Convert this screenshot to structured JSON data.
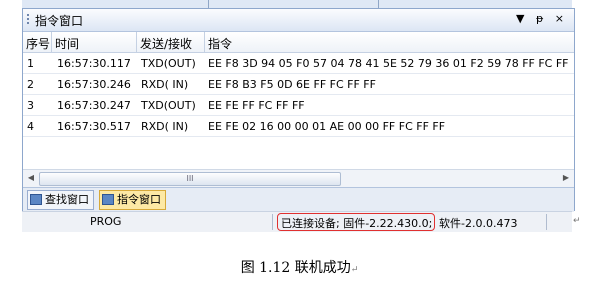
{
  "window": {
    "title": "指令窗口",
    "buttons": {
      "dropdown": "▼",
      "pin": "ᵽ",
      "close": "×"
    }
  },
  "grid": {
    "columns": [
      "序号",
      "时间",
      "发送/接收",
      "指令"
    ],
    "rows": [
      {
        "index": "1",
        "time": "16:57:30.117",
        "dir": "TXD(OUT)",
        "cmd": "EE F8 3D 94 05 F0  57 04 78 41  5E 52 79 36  01 F2 59 78  FF FC FF"
      },
      {
        "index": "2",
        "time": "16:57:30.246",
        "dir": "RXD( IN)",
        "cmd": "EE F8 B3 F5 0D 6E FF FC FF FF"
      },
      {
        "index": "3",
        "time": "16:57:30.247",
        "dir": "TXD(OUT)",
        "cmd": "EE FE FF FC FF FF"
      },
      {
        "index": "4",
        "time": "16:57:30.517",
        "dir": "RXD( IN)",
        "cmd": "EE FE 02 16 00 00 01 AE 00 00 FF FC FF FF"
      }
    ]
  },
  "scrollbar": {
    "left": "◀",
    "right": "▶",
    "thumb": "III"
  },
  "tabs": [
    {
      "label": "查找窗口",
      "active": false
    },
    {
      "label": "指令窗口",
      "active": true
    }
  ],
  "status": {
    "mode": "PROG",
    "connection": "已连接设备; 固件-2.22.430.0;",
    "software": "软件-2.0.0.473",
    "highlight_color": "#e03030"
  },
  "caption": "图 1.12 联机成功",
  "return_mark": "↵"
}
